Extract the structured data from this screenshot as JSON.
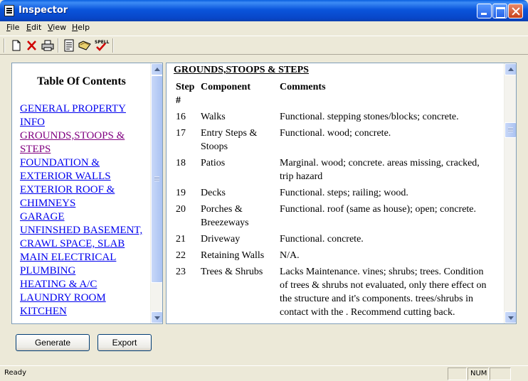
{
  "window": {
    "title": "Inspector"
  },
  "menu": {
    "items": [
      "File",
      "Edit",
      "View",
      "Help"
    ]
  },
  "toolbar": {
    "icons": [
      "new-document-icon",
      "delete-icon",
      "print-icon",
      "report-icon",
      "open-icon",
      "spell-check-icon"
    ],
    "spell_label": "SPELL"
  },
  "toc": {
    "title": "Table Of Contents",
    "items": [
      "GENERAL PROPERTY INFO",
      "GROUNDS,STOOPS & STEPS",
      "FOUNDATION & EXTERIOR WALLS",
      "EXTERIOR ROOF & CHIMNEYS",
      "GARAGE",
      "UNFINSHED BASEMENT, CRAWL SPACE, SLAB",
      "MAIN ELECTRICAL",
      "PLUMBING",
      "HEATING & A/C",
      "LAUNDRY ROOM",
      "KITCHEN"
    ],
    "visited_index": 1
  },
  "section": {
    "heading": "GROUNDS,STOOPS & STEPS",
    "columns": [
      "Step #",
      "Component",
      "Comments"
    ],
    "rows": [
      {
        "step": "16",
        "component": "Walks",
        "comment": "Functional. stepping stones/blocks; concrete."
      },
      {
        "step": "17",
        "component": "Entry Steps & Stoops",
        "comment": "Functional. wood; concrete."
      },
      {
        "step": "18",
        "component": "Patios",
        "comment": "Marginal. wood; concrete. areas missing, cracked, trip hazard"
      },
      {
        "step": "19",
        "component": "Decks",
        "comment": "Functional. steps; railing; wood."
      },
      {
        "step": "20",
        "component": "Porches & Breezeways",
        "comment": "Functional. roof (same as house); open; concrete."
      },
      {
        "step": "21",
        "component": "Driveway",
        "comment": "Functional. concrete."
      },
      {
        "step": "22",
        "component": "Retaining Walls",
        "comment": "N/A."
      },
      {
        "step": "23",
        "component": "Trees & Shrubs",
        "comment": "Lacks Maintenance. vines; shrubs; trees. Condition of trees & shrubs not evaluated, only there effect on the structure and it's components. trees/shrubs in contact with the . Recommend cutting back."
      }
    ]
  },
  "buttons": {
    "generate": "Generate",
    "export": "Export"
  },
  "status": {
    "text": "Ready",
    "num": "NUM"
  }
}
